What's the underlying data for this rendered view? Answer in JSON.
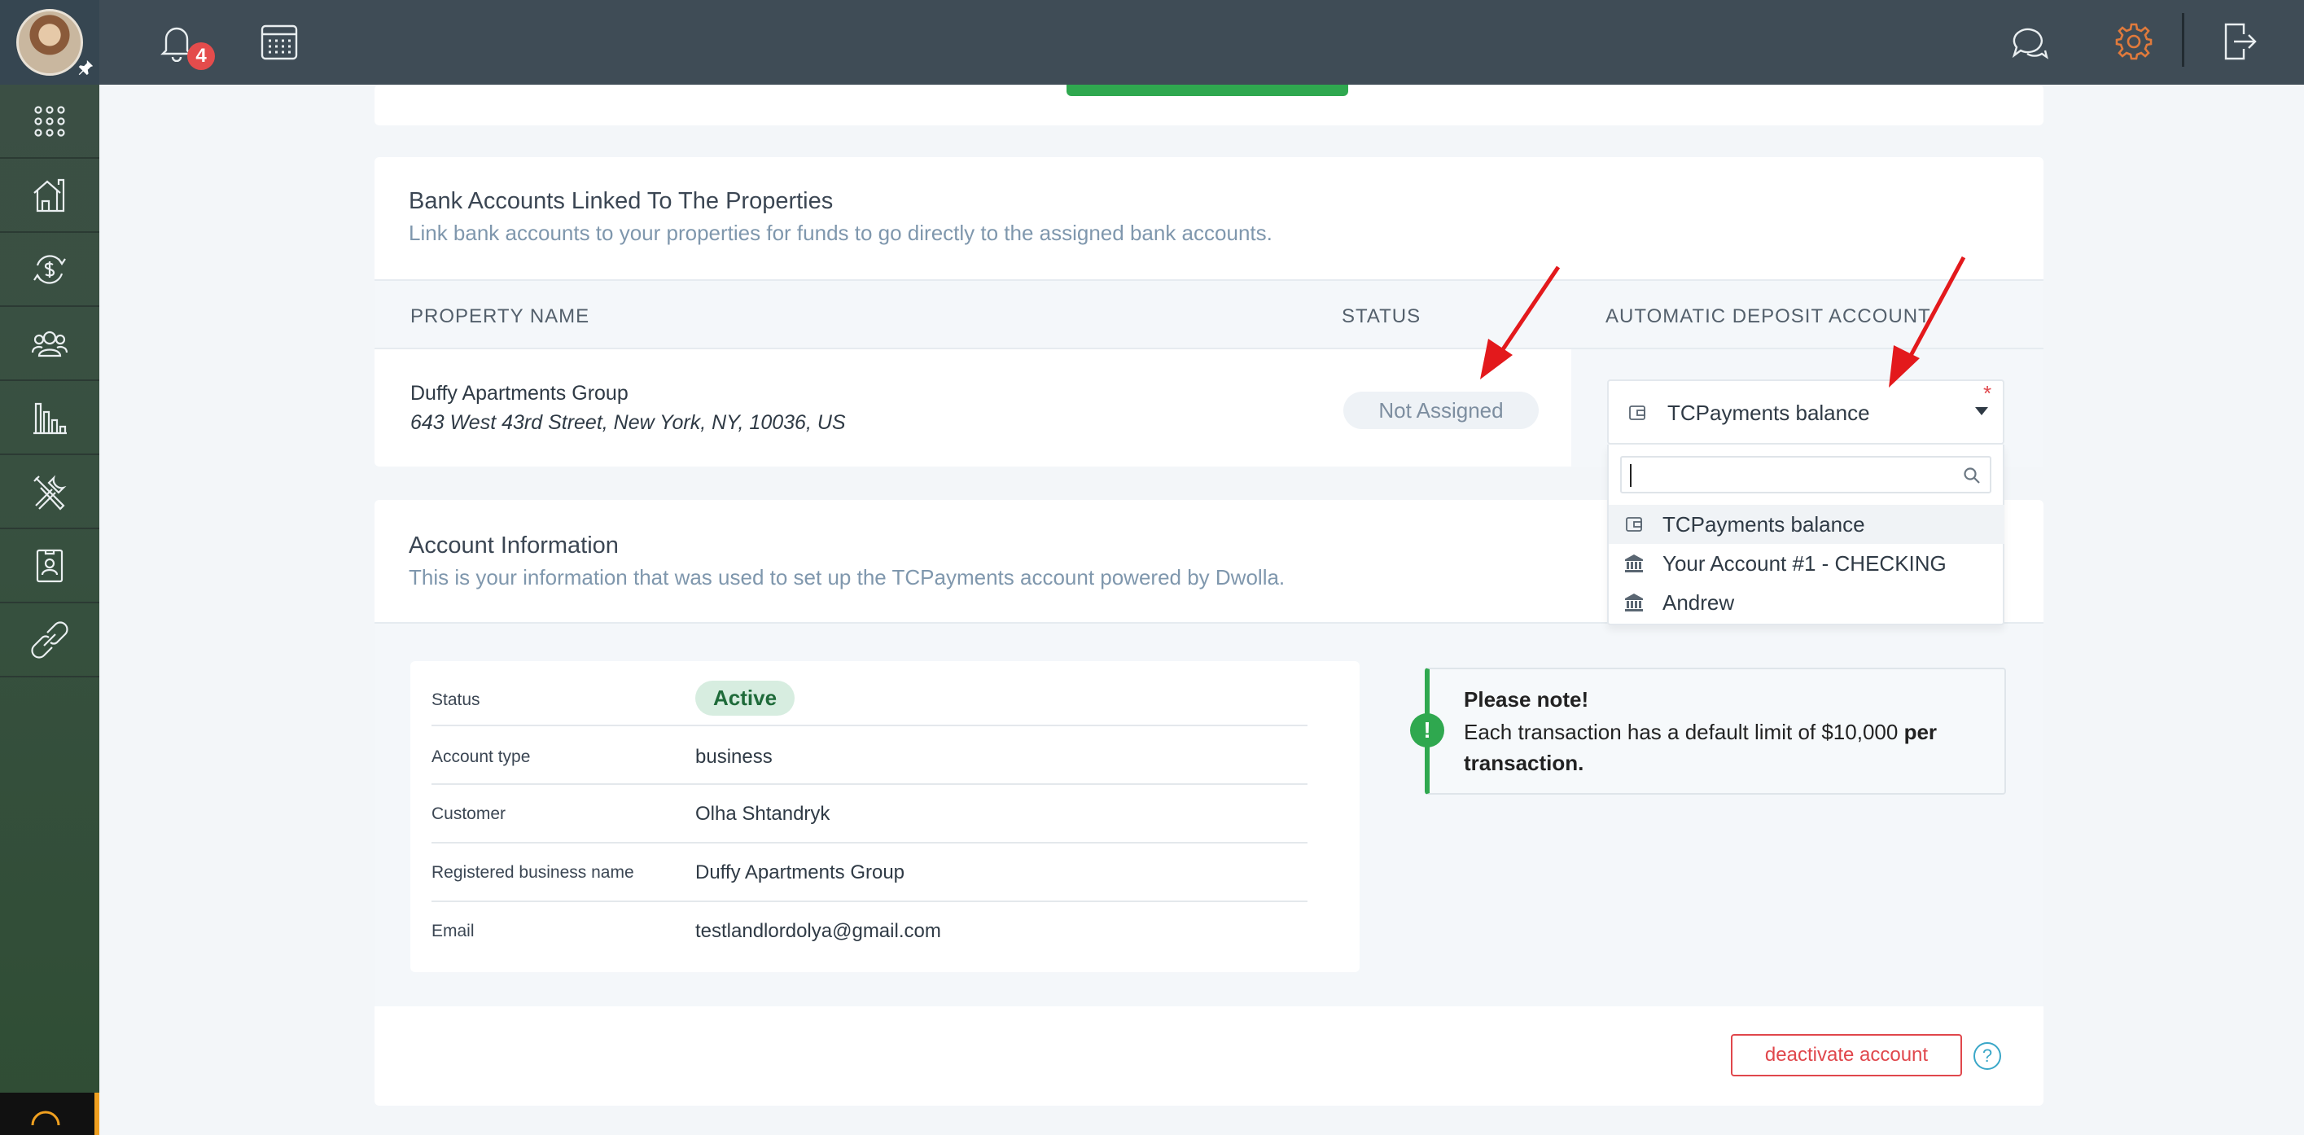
{
  "topbar": {
    "notifications_count": "4"
  },
  "sidebar": {
    "items": [
      "apps",
      "properties",
      "payments",
      "people",
      "reports",
      "maintenance",
      "tenant-screening",
      "integrations"
    ]
  },
  "bank_section": {
    "title": "Bank Accounts Linked To The Properties",
    "subtitle": "Link bank accounts to your properties for funds to go directly to the assigned bank accounts.",
    "columns": {
      "property": "PROPERTY NAME",
      "status": "STATUS",
      "deposit": "AUTOMATIC DEPOSIT ACCOUNT"
    },
    "rows": [
      {
        "name": "Duffy Apartments Group",
        "address": "643 West 43rd Street, New York, NY, 10036, US",
        "status": "Not Assigned",
        "deposit_selected": "TCPayments balance"
      }
    ]
  },
  "deposit_dropdown": {
    "required_mark": "*",
    "search_value": "",
    "options": [
      {
        "label": "TCPayments balance",
        "icon": "wallet-icon"
      },
      {
        "label": "Your Account #1 - CHECKING",
        "icon": "bank-icon"
      },
      {
        "label": "Andrew",
        "icon": "bank-icon"
      }
    ]
  },
  "account_section": {
    "title": "Account Information",
    "subtitle": "This is your information that was used to set up the TCPayments account powered by Dwolla.",
    "fields": [
      {
        "label": "Status",
        "value": "Active"
      },
      {
        "label": "Account type",
        "value": "business"
      },
      {
        "label": "Customer",
        "value": "Olha Shtandryk"
      },
      {
        "label": "Registered business name",
        "value": "Duffy Apartments Group"
      },
      {
        "label": "Email",
        "value": "testlandlordolya@gmail.com"
      }
    ],
    "note": {
      "title": "Please note!",
      "text_start": "Each transaction has a default limit of $10,000 ",
      "text_bold": "per transaction."
    },
    "deactivate_label": "deactivate account",
    "help_label": "?"
  },
  "colors": {
    "accent_green": "#2fa84f",
    "danger_red": "#e0474c",
    "topbar": "#3f4c56",
    "gear_orange": "#e07a3c"
  }
}
